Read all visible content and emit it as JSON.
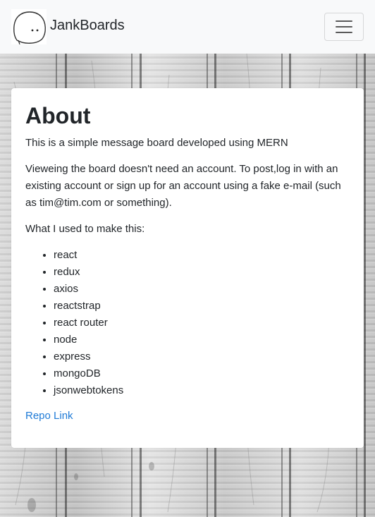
{
  "navbar": {
    "brand_name": "JankBoards",
    "logo_icon": "doodle-face-logo"
  },
  "about": {
    "title": "About",
    "intro": "This is a simple message board developed using MERN",
    "account_note": "Vieweing the board doesn't need an account. To post,log in with an existing account or sign up for an account using a fake e-mail (such as tim@tim.com or something).",
    "tools_heading": "What I used to make this:",
    "tools": [
      "react",
      "redux",
      "axios",
      "reactstrap",
      "react router",
      "node",
      "express",
      "mongoDB",
      "jsonwebtokens"
    ],
    "repo_link_label": "Repo Link"
  },
  "colors": {
    "navbar_bg": "#f8f9fa",
    "link": "#1e7ad6",
    "text": "#212529"
  }
}
